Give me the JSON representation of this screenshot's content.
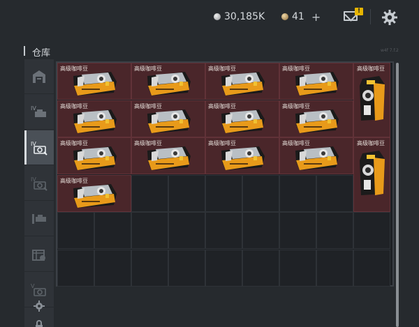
{
  "hud": {
    "silver_amount": "30,185K",
    "bronze_amount": "41",
    "plus_label": "+",
    "mail_badge": "!"
  },
  "panel": {
    "title": "仓库",
    "version": "w4f 7.f.2"
  },
  "sidebar": {
    "items": [
      {
        "icon": "garage-icon"
      },
      {
        "icon": "tier-iv-vehicle-icon"
      },
      {
        "icon": "tier-iv-modules-icon",
        "active": true
      },
      {
        "icon": "tier-iv-modules-faded-icon"
      },
      {
        "icon": "vehicle-list-icon"
      },
      {
        "icon": "crate-icon"
      },
      {
        "icon": "tier-v-modules-icon"
      },
      {
        "icon": "lock-icon"
      },
      {
        "icon": "settings-icon"
      }
    ]
  },
  "inventory": {
    "item_name": "高级咖啡豆",
    "wide_items": 13,
    "tall_items": 2
  },
  "colors": {
    "accent": "#e6b400",
    "item_bg": "#4a262a",
    "panel_bg": "#262a2e"
  }
}
